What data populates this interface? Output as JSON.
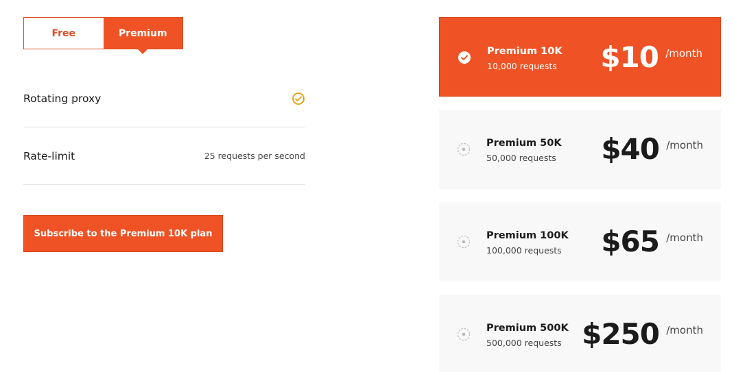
{
  "toggle": {
    "free_label": "Free",
    "premium_label": "Premium",
    "selected": "Premium"
  },
  "features": [
    {
      "label": "Rotating proxy",
      "value_icon": "check-circle-icon"
    },
    {
      "label": "Rate-limit",
      "value": "25 requests per second"
    }
  ],
  "subscribe_label": "Subscribe to the Premium 10K plan",
  "plans": [
    {
      "name": "Premium 10K",
      "requests": "10,000 requests",
      "price": "$10",
      "period": "/month",
      "selected": true
    },
    {
      "name": "Premium 50K",
      "requests": "50,000 requests",
      "price": "$40",
      "period": "/month",
      "selected": false
    },
    {
      "name": "Premium 100K",
      "requests": "100,000 requests",
      "price": "$65",
      "period": "/month",
      "selected": false
    },
    {
      "name": "Premium 500K",
      "requests": "500,000 requests",
      "price": "$250",
      "period": "/month",
      "selected": false
    }
  ],
  "colors": {
    "accent": "#ef5325",
    "check_icon": "#e0a100",
    "card_background": "#f8f8f8"
  }
}
